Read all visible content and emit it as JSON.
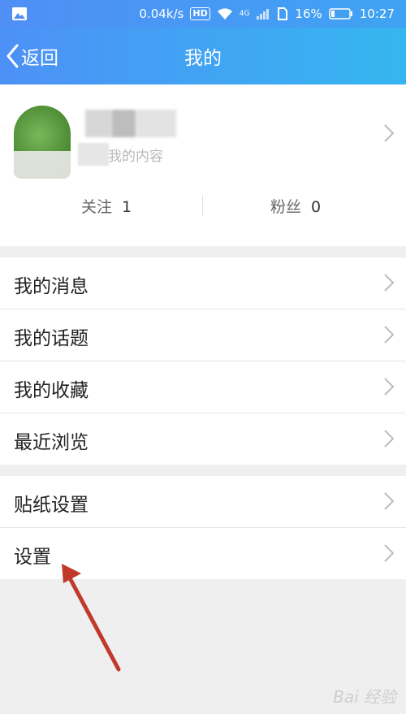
{
  "status_bar": {
    "speed": "0.04k/s",
    "hd": "HD",
    "network": "4G",
    "battery": "16%",
    "time": "10:27"
  },
  "nav": {
    "back_label": "返回",
    "title": "我的"
  },
  "profile": {
    "subtitle": "我的内容",
    "follow_label": "关注",
    "follow_count": "1",
    "fans_label": "粉丝",
    "fans_count": "0"
  },
  "menu_group_1": [
    {
      "label": "我的消息"
    },
    {
      "label": "我的话题"
    },
    {
      "label": "我的收藏"
    },
    {
      "label": "最近浏览"
    }
  ],
  "menu_group_2": [
    {
      "label": "贴纸设置"
    },
    {
      "label": "设置"
    }
  ],
  "watermark": "Bai 经验",
  "colors": {
    "header_start": "#4d91f6",
    "header_end": "#35b6f0",
    "annotation_arrow": "#c0392b"
  }
}
